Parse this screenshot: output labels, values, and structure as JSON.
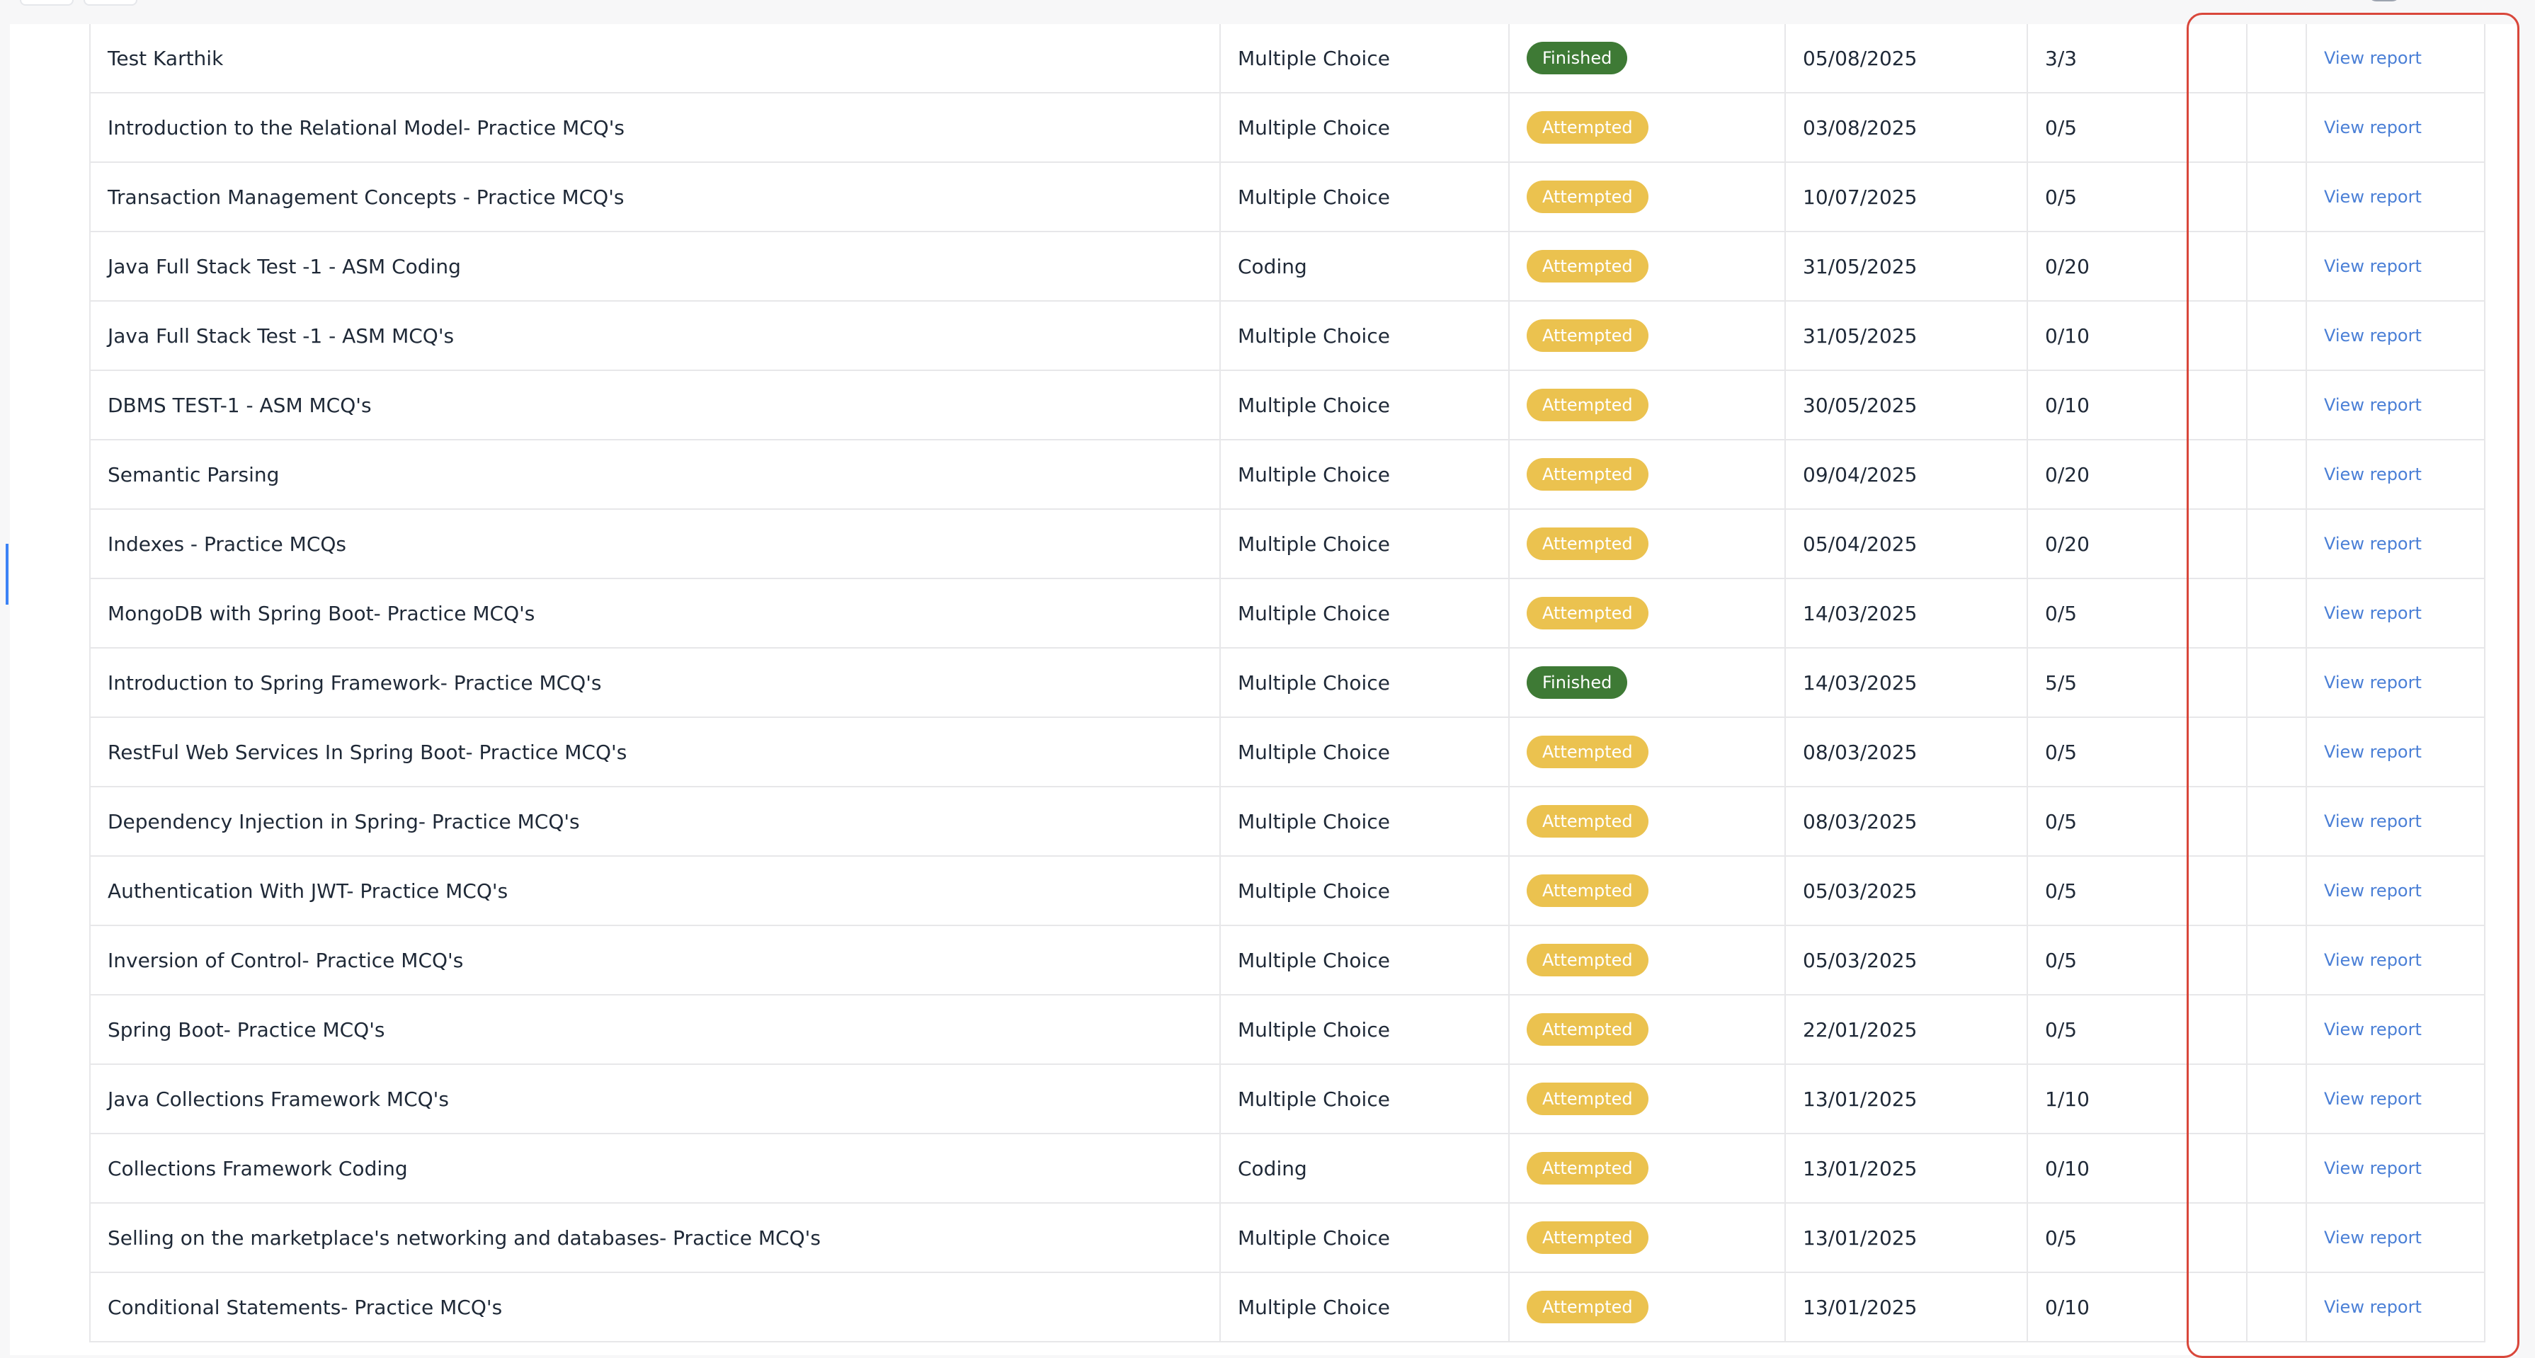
{
  "colors": {
    "finished_badge": "#3e7a35",
    "attempted_badge": "#ebc24f",
    "link": "#4a7fd6",
    "highlight": "#d9473b"
  },
  "rows": [
    {
      "title": "Test Karthik",
      "type": "Multiple Choice",
      "status": "Finished",
      "date": "05/08/2025",
      "score": "3/3",
      "action": "View report"
    },
    {
      "title": "Introduction to the Relational Model- Practice MCQ's",
      "type": "Multiple Choice",
      "status": "Attempted",
      "date": "03/08/2025",
      "score": "0/5",
      "action": "View report"
    },
    {
      "title": "Transaction Management Concepts - Practice MCQ's",
      "type": "Multiple Choice",
      "status": "Attempted",
      "date": "10/07/2025",
      "score": "0/5",
      "action": "View report"
    },
    {
      "title": "Java Full Stack Test -1 - ASM Coding",
      "type": "Coding",
      "status": "Attempted",
      "date": "31/05/2025",
      "score": "0/20",
      "action": "View report"
    },
    {
      "title": "Java Full Stack Test -1 - ASM MCQ's",
      "type": "Multiple Choice",
      "status": "Attempted",
      "date": "31/05/2025",
      "score": "0/10",
      "action": "View report"
    },
    {
      "title": "DBMS TEST-1 - ASM MCQ's",
      "type": "Multiple Choice",
      "status": "Attempted",
      "date": "30/05/2025",
      "score": "0/10",
      "action": "View report"
    },
    {
      "title": "Semantic Parsing",
      "type": "Multiple Choice",
      "status": "Attempted",
      "date": "09/04/2025",
      "score": "0/20",
      "action": "View report"
    },
    {
      "title": "Indexes - Practice MCQs",
      "type": "Multiple Choice",
      "status": "Attempted",
      "date": "05/04/2025",
      "score": "0/20",
      "action": "View report"
    },
    {
      "title": "MongoDB with Spring Boot- Practice MCQ's",
      "type": "Multiple Choice",
      "status": "Attempted",
      "date": "14/03/2025",
      "score": "0/5",
      "action": "View report"
    },
    {
      "title": "Introduction to Spring Framework- Practice MCQ's",
      "type": "Multiple Choice",
      "status": "Finished",
      "date": "14/03/2025",
      "score": "5/5",
      "action": "View report"
    },
    {
      "title": "RestFul Web Services In Spring Boot- Practice MCQ's",
      "type": "Multiple Choice",
      "status": "Attempted",
      "date": "08/03/2025",
      "score": "0/5",
      "action": "View report"
    },
    {
      "title": "Dependency Injection in Spring- Practice MCQ's",
      "type": "Multiple Choice",
      "status": "Attempted",
      "date": "08/03/2025",
      "score": "0/5",
      "action": "View report"
    },
    {
      "title": "Authentication With JWT- Practice MCQ's",
      "type": "Multiple Choice",
      "status": "Attempted",
      "date": "05/03/2025",
      "score": "0/5",
      "action": "View report"
    },
    {
      "title": "Inversion of Control- Practice MCQ's",
      "type": "Multiple Choice",
      "status": "Attempted",
      "date": "05/03/2025",
      "score": "0/5",
      "action": "View report"
    },
    {
      "title": "Spring Boot- Practice MCQ's",
      "type": "Multiple Choice",
      "status": "Attempted",
      "date": "22/01/2025",
      "score": "0/5",
      "action": "View report"
    },
    {
      "title": "Java Collections Framework MCQ's",
      "type": "Multiple Choice",
      "status": "Attempted",
      "date": "13/01/2025",
      "score": "1/10",
      "action": "View report"
    },
    {
      "title": "Collections Framework Coding",
      "type": "Coding",
      "status": "Attempted",
      "date": "13/01/2025",
      "score": "0/10",
      "action": "View report"
    },
    {
      "title": "Selling on the marketplace's networking and databases- Practice MCQ's",
      "type": "Multiple Choice",
      "status": "Attempted",
      "date": "13/01/2025",
      "score": "0/5",
      "action": "View report"
    },
    {
      "title": "Conditional Statements- Practice MCQ's",
      "type": "Multiple Choice",
      "status": "Attempted",
      "date": "13/01/2025",
      "score": "0/10",
      "action": "View report"
    }
  ]
}
